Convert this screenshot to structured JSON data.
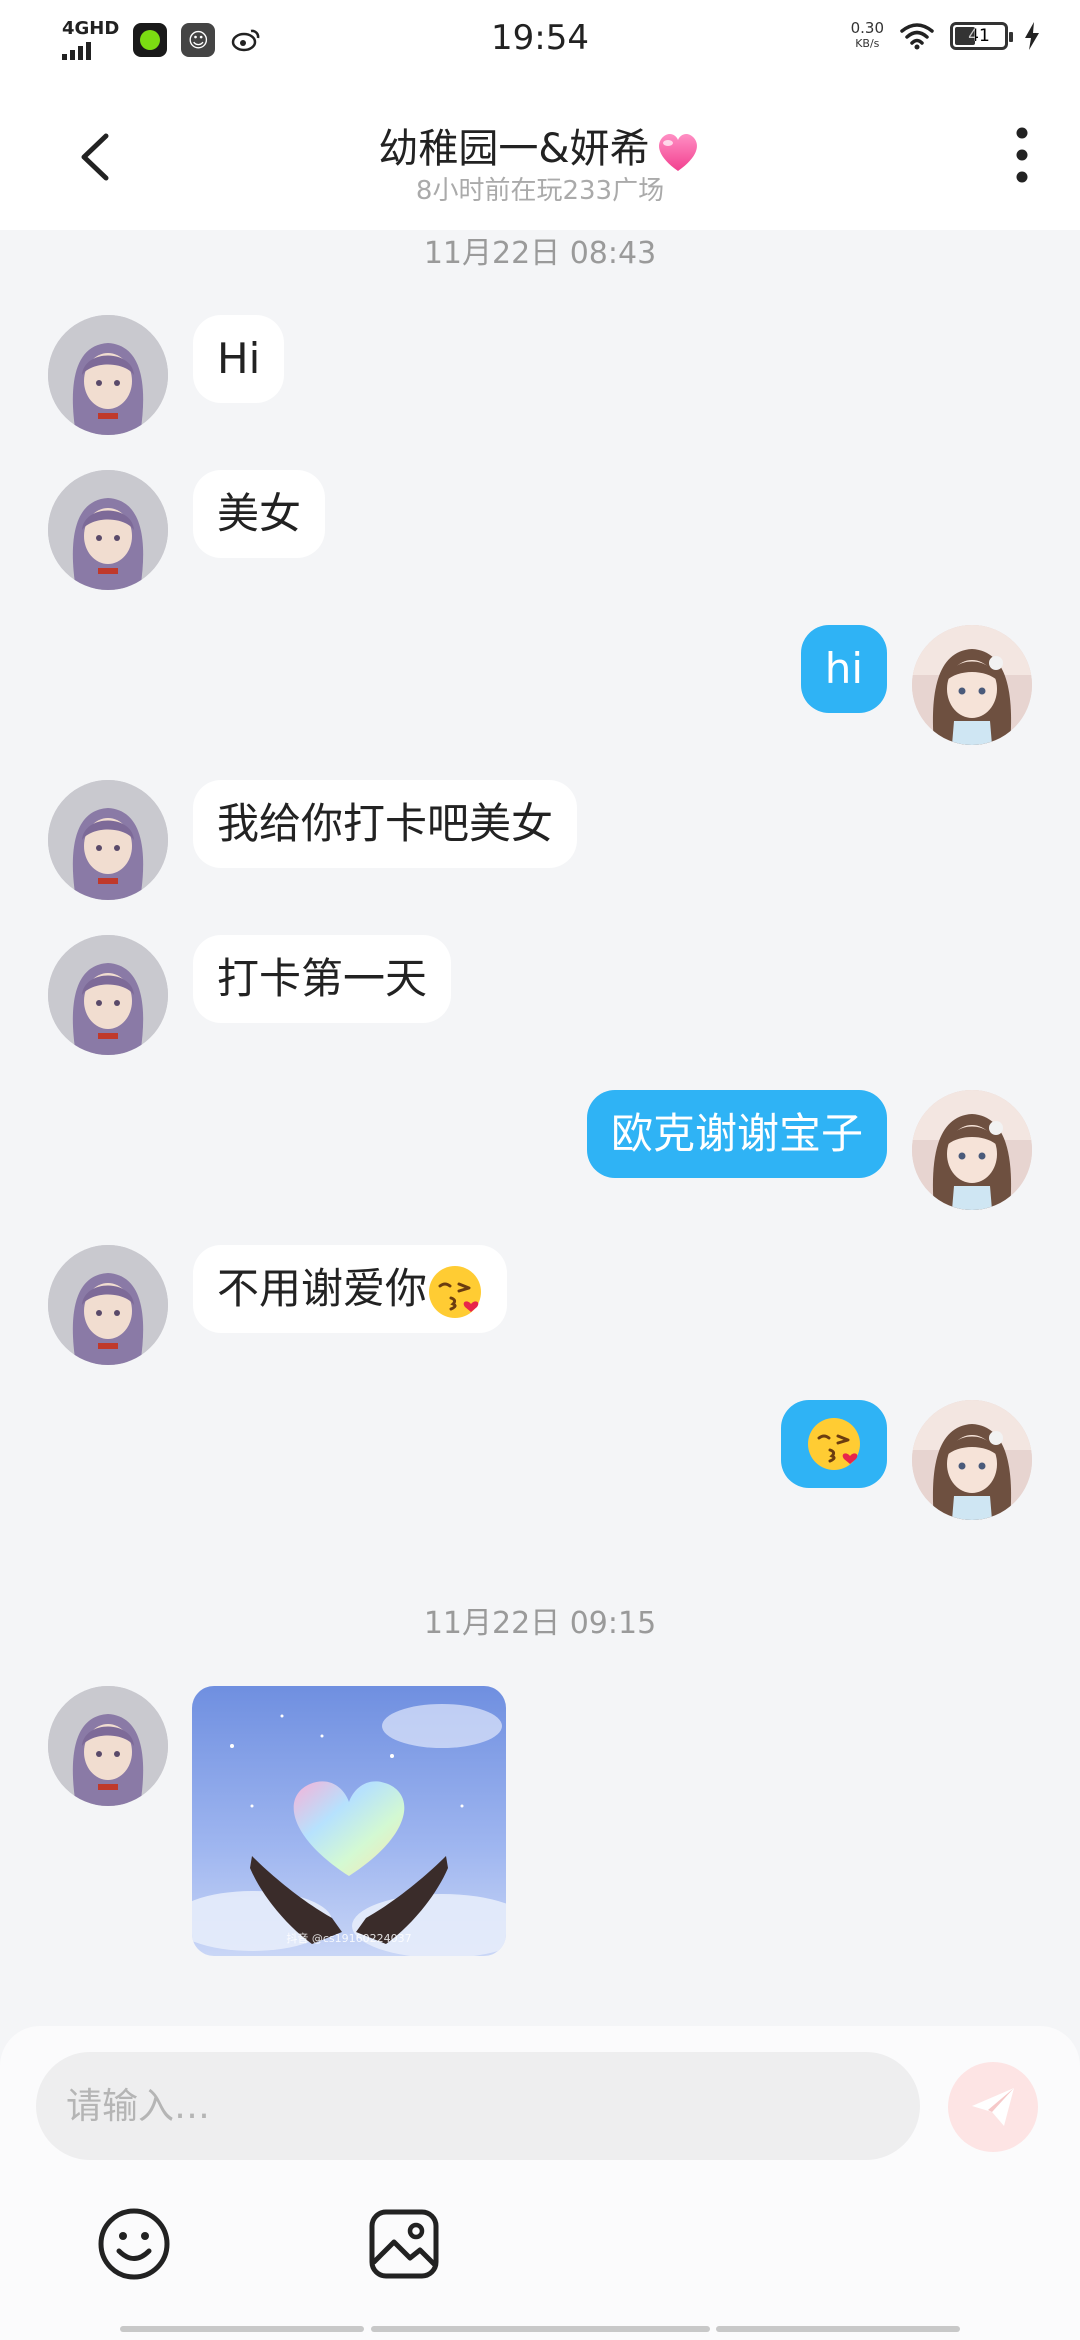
{
  "status_bar": {
    "network": "4GHD",
    "time": "19:54",
    "speed_value": "0.30",
    "speed_unit": "KB/s",
    "battery_level": "41",
    "battery_fraction": 0.41
  },
  "header": {
    "title": "幼稚园一&妍希",
    "subtitle": "8小时前在玩233广场"
  },
  "timestamps": {
    "first": "11月22日 08:43",
    "second": "11月22日 09:15"
  },
  "messages": [
    {
      "text": "Hi"
    },
    {
      "text": "美女"
    },
    {
      "text": "hi"
    },
    {
      "text": "我给你打卡吧美女"
    },
    {
      "text": "打卡第一天"
    },
    {
      "text": "欧克谢谢宝子"
    },
    {
      "text": "不用谢爱你"
    },
    {
      "text": ""
    }
  ],
  "image_message": {
    "caption": "抖音 @cs19160224037"
  },
  "composer": {
    "placeholder": "请输入…"
  },
  "colors": {
    "outgoing_bubble": "#2fb3f5",
    "incoming_bubble": "#ffffff",
    "background": "#f4f5f7",
    "send_button": "#fde4e4"
  }
}
